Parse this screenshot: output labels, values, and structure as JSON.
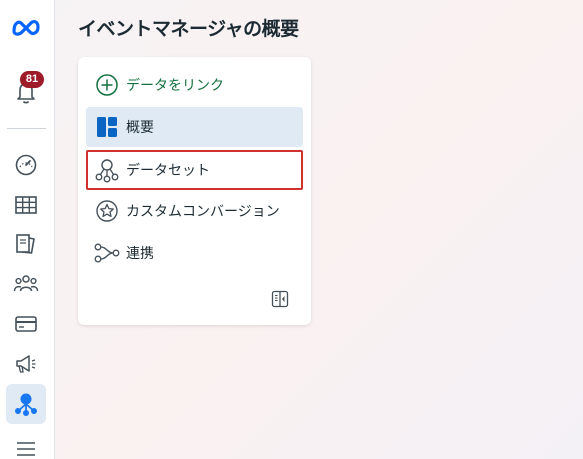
{
  "page": {
    "title": "イベントマネージャの概要"
  },
  "rail": {
    "logo_icon": "meta-logo-icon",
    "notifications": {
      "icon": "bell-icon",
      "badge_count": "81"
    },
    "items": [
      {
        "icon": "gauge-icon"
      },
      {
        "icon": "table-icon"
      },
      {
        "icon": "pages-icon"
      },
      {
        "icon": "people-icon"
      },
      {
        "icon": "credit-card-icon"
      },
      {
        "icon": "megaphone-icon"
      },
      {
        "icon": "events-manager-icon",
        "active": true
      },
      {
        "icon": "menu-icon"
      }
    ]
  },
  "menu": {
    "link_data": "データをリンク",
    "overview": "概要",
    "datasets": "データセット",
    "custom_conversions": "カスタムコンバージョン",
    "integrations": "連携"
  },
  "colors": {
    "accent_blue": "#1877f2",
    "link_green": "#13703f",
    "active_bg": "#dfeaf5",
    "highlight_border": "#d0312d",
    "badge": "#9e1b2a"
  }
}
